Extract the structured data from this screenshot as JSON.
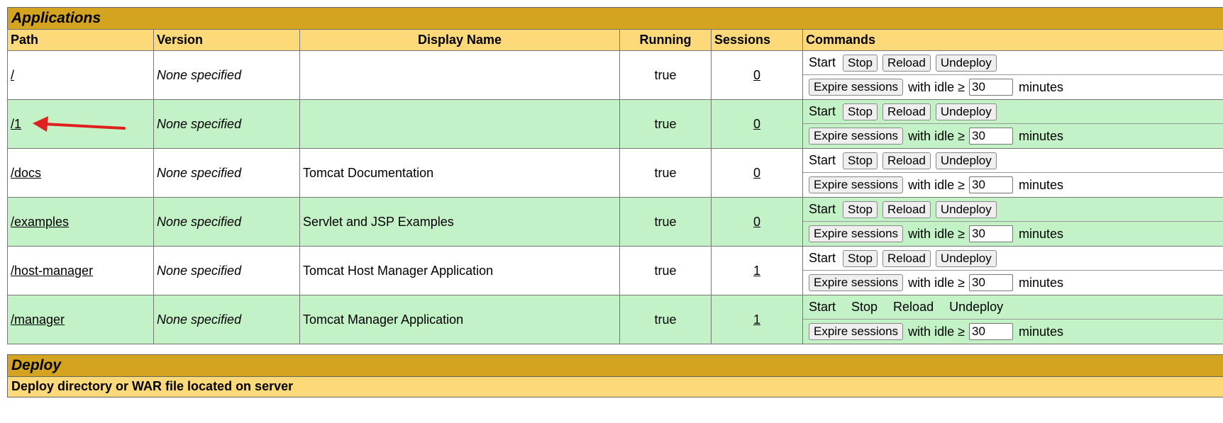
{
  "applications": {
    "title": "Applications",
    "headers": {
      "path": "Path",
      "version": "Version",
      "display_name": "Display Name",
      "running": "Running",
      "sessions": "Sessions",
      "commands": "Commands"
    },
    "rows": [
      {
        "path": "/",
        "version": "None specified",
        "display_name": "",
        "running": "true",
        "sessions": "0",
        "idle": "30"
      },
      {
        "path": "/1",
        "version": "None specified",
        "display_name": "",
        "running": "true",
        "sessions": "0",
        "idle": "30"
      },
      {
        "path": "/docs",
        "version": "None specified",
        "display_name": "Tomcat Documentation",
        "running": "true",
        "sessions": "0",
        "idle": "30"
      },
      {
        "path": "/examples",
        "version": "None specified",
        "display_name": "Servlet and JSP Examples",
        "running": "true",
        "sessions": "0",
        "idle": "30"
      },
      {
        "path": "/host-manager",
        "version": "None specified",
        "display_name": "Tomcat Host Manager Application",
        "running": "true",
        "sessions": "1",
        "idle": "30"
      },
      {
        "path": "/manager",
        "version": "None specified",
        "display_name": "Tomcat Manager Application",
        "running": "true",
        "sessions": "1",
        "idle": "30"
      }
    ],
    "commands": {
      "start": "Start",
      "stop": "Stop",
      "reload": "Reload",
      "undeploy": "Undeploy",
      "expire": "Expire sessions",
      "with_idle": "with idle ≥",
      "minutes": "minutes"
    }
  },
  "deploy": {
    "title": "Deploy",
    "subtitle": "Deploy directory or WAR file located on server"
  },
  "annotation": {
    "arrow_color": "#e02020"
  },
  "colors": {
    "title_bar": "#d4a420",
    "header": "#fdd97a",
    "row_green": "#c3f2c6"
  }
}
